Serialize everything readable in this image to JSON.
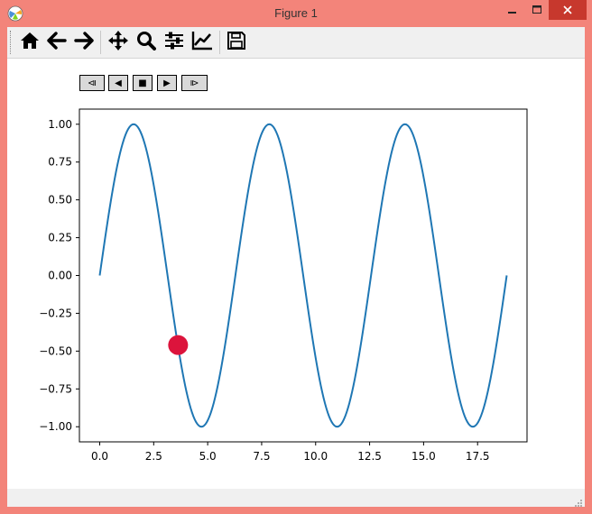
{
  "window": {
    "title": "Figure 1",
    "controls": {
      "minimize": "minimize",
      "maximize": "maximize",
      "close": "close"
    }
  },
  "toolbar": {
    "items": [
      {
        "name": "home",
        "icon": "home-icon"
      },
      {
        "name": "back",
        "icon": "arrow-left-icon"
      },
      {
        "name": "forward",
        "icon": "arrow-right-icon"
      },
      {
        "name": "pan",
        "icon": "move-arrows-icon"
      },
      {
        "name": "zoom",
        "icon": "magnifier-icon"
      },
      {
        "name": "subplots",
        "icon": "sliders-icon"
      },
      {
        "name": "customize",
        "icon": "line-chart-icon"
      },
      {
        "name": "save",
        "icon": "floppy-disk-icon"
      }
    ]
  },
  "animation_controls": {
    "buttons": [
      {
        "label": "⧏",
        "name": "step-back"
      },
      {
        "label": "◀",
        "name": "play-backward"
      },
      {
        "label": "■",
        "name": "stop"
      },
      {
        "label": "▶",
        "name": "play-forward"
      },
      {
        "label": "⧐",
        "name": "step-forward"
      }
    ]
  },
  "chart_data": {
    "type": "line",
    "title": "",
    "xlabel": "",
    "ylabel": "",
    "function": "sin(x)",
    "x_range": [
      0,
      18.85
    ],
    "xlim": [
      -0.94,
      19.79
    ],
    "ylim": [
      -1.1,
      1.1
    ],
    "x_ticks": [
      "0.0",
      "2.5",
      "5.0",
      "7.5",
      "10.0",
      "12.5",
      "15.0",
      "17.5"
    ],
    "y_ticks": [
      "1.00",
      "0.75",
      "0.50",
      "0.25",
      "0.00",
      "−0.25",
      "−0.50",
      "−0.75",
      "−1.00"
    ],
    "x_tick_values": [
      0,
      2.5,
      5,
      7.5,
      10,
      12.5,
      15,
      17.5
    ],
    "y_tick_values": [
      1,
      0.75,
      0.5,
      0.25,
      0,
      -0.25,
      -0.5,
      -0.75,
      -1
    ],
    "series": [
      {
        "color": "#1f77b4"
      }
    ],
    "marker": {
      "x": 3.63,
      "y": -0.46,
      "color": "#dc143c"
    },
    "grid": false
  }
}
